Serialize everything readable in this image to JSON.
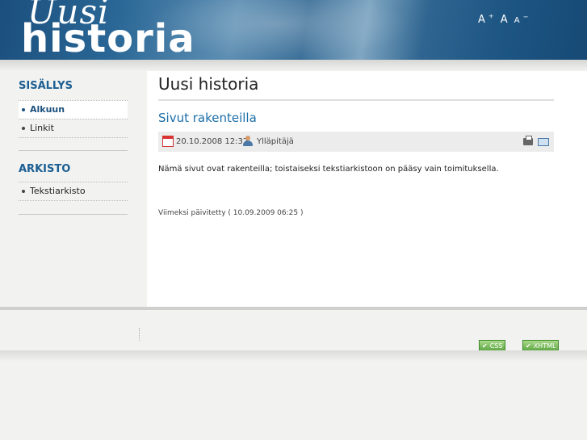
{
  "header": {
    "logo_top": "Uusi",
    "logo_main": "historia",
    "font_size_controls": {
      "increase": "A",
      "increase_sup": "+",
      "reset": "A",
      "decrease": "A",
      "decrease_sup": "−"
    }
  },
  "sidebar": {
    "sections": [
      {
        "title": "SISÄLLYS",
        "items": [
          {
            "label": "Alkuun",
            "active": true
          },
          {
            "label": "Linkit",
            "active": false
          }
        ]
      },
      {
        "title": "ARKISTO",
        "items": [
          {
            "label": "Tekstiarkisto",
            "active": false
          }
        ]
      }
    ]
  },
  "main": {
    "page_title": "Uusi historia",
    "article": {
      "title": "Sivut rakenteilla",
      "date": "20.10.2008 12:32",
      "author": "Ylläpitäjä",
      "body": "Nämä sivut ovat rakenteilla; toistaiseksi tekstiarkistoon on pääsy vain toimituksella.",
      "updated": "Viimeksi päivitetty ( 10.09.2009 06:25 )"
    },
    "icons": {
      "date": "calendar-icon",
      "author": "user-icon",
      "print": "print-icon",
      "email": "email-icon"
    }
  },
  "footer": {
    "badges": [
      {
        "label": "CSS"
      },
      {
        "label": "XHTML"
      }
    ]
  },
  "colors": {
    "accent": "#1b5f93",
    "link": "#1b6ea8",
    "header_blue": "#1b4f7d",
    "badge_green": "#5aa540"
  }
}
